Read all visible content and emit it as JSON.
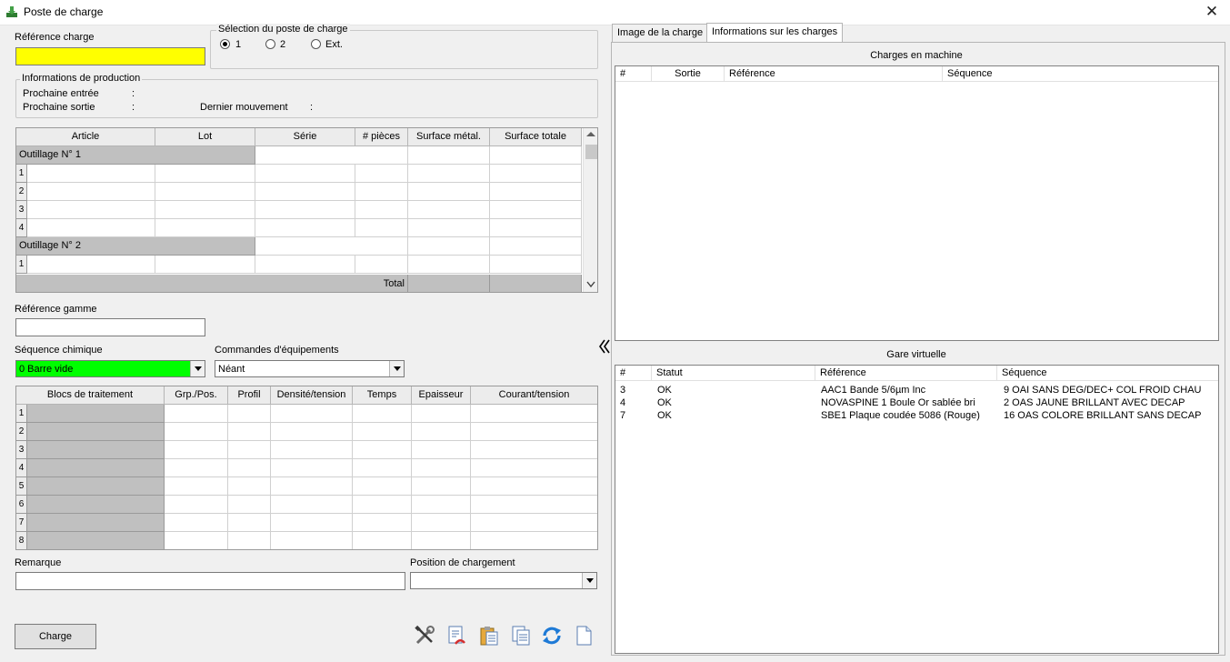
{
  "window": {
    "title": "Poste de charge",
    "close": "✕"
  },
  "left": {
    "ref_charge_label": "Référence charge",
    "ref_charge_value": "",
    "selection": {
      "legend": "Sélection du poste de charge",
      "opt1": "1",
      "opt2": "2",
      "opt3": "Ext.",
      "selected": "1"
    },
    "production": {
      "legend": "Informations de production",
      "next_in": "Prochaine entrée",
      "next_out": "Prochaine sortie",
      "last_move": "Dernier mouvement",
      "colon": ":"
    },
    "articles_grid": {
      "columns": [
        "Article",
        "Lot",
        "Série",
        "# pièces",
        "Surface métal.",
        "Surface totale"
      ],
      "group1": "Outillage N° 1",
      "group1_rows": [
        "1",
        "2",
        "3",
        "4"
      ],
      "group2": "Outillage N° 2",
      "group2_rows": [
        "1"
      ],
      "total_label": "Total"
    },
    "ref_gamme_label": "Référence gamme",
    "ref_gamme_value": "",
    "sequence_label": "Séquence chimique",
    "sequence_value": "0 Barre vide",
    "equipment_label": "Commandes d'équipements",
    "equipment_value": "Néant",
    "blocs_grid": {
      "columns": [
        "Blocs de traitement",
        "Grp./Pos.",
        "Profil",
        "Densité/tension",
        "Temps",
        "Epaisseur",
        "Courant/tension"
      ],
      "rows": [
        "1",
        "2",
        "3",
        "4",
        "5",
        "6",
        "7",
        "8"
      ]
    },
    "remark_label": "Remarque",
    "remark_value": "",
    "position_label": "Position de chargement",
    "position_value": "",
    "charge_button": "Charge"
  },
  "tabs": [
    {
      "label": "Image de la charge",
      "active": false
    },
    {
      "label": "Informations sur les charges",
      "active": true
    }
  ],
  "right": {
    "machine_title": "Charges en machine",
    "machine_columns": [
      "#",
      "Sortie",
      "Référence",
      "Séquence"
    ],
    "virtual_title": "Gare virtuelle",
    "virtual_columns": [
      "#",
      "Statut",
      "Référence",
      "Séquence"
    ],
    "virtual_rows": [
      {
        "num": "3",
        "status": "OK",
        "ref": "AAC1 Bande 5/6µm Inc",
        "seq": "9 OAI SANS DEG/DEC+ COL FROID CHAU"
      },
      {
        "num": "4",
        "status": "OK",
        "ref": "NOVASPINE 1 Boule Or sablée bri",
        "seq": "2 OAS JAUNE BRILLANT AVEC DECAP"
      },
      {
        "num": "7",
        "status": "OK",
        "ref": "SBE1 Plaque coudée 5086 (Rouge)",
        "seq": "16 OAS COLORE BRILLANT SANS DECAP"
      }
    ]
  },
  "toolbar_icons": [
    "tools-icon",
    "delete-document-icon",
    "clipboard-icon",
    "copy-document-icon",
    "refresh-icon",
    "blank-document-icon"
  ],
  "colors": {
    "ref_charge_bg": "#ffff00",
    "sequence_bg": "#00ff00",
    "refresh": "#1e7ad6"
  }
}
